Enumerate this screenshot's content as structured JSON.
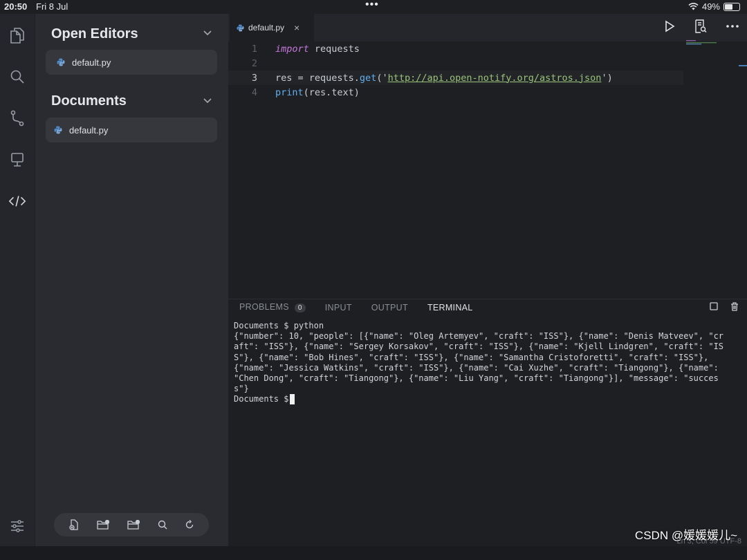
{
  "status_bar": {
    "time": "20:50",
    "date": "Fri 8 Jul",
    "battery": "49%",
    "battery_level": 0.49
  },
  "activity_bar": [
    "files-icon",
    "search-icon",
    "source-control-icon",
    "remote-icon",
    "code-icon",
    "settings-sliders-icon"
  ],
  "sidebar": {
    "open_editors": {
      "title": "Open Editors",
      "files": [
        "default.py"
      ]
    },
    "documents": {
      "title": "Documents",
      "files": [
        "default.py"
      ]
    },
    "toolbar": [
      "new-file-icon",
      "new-folder-icon",
      "open-folder-icon",
      "search-icon",
      "refresh-icon"
    ]
  },
  "editor": {
    "tab": {
      "label": "default.py",
      "close": "×"
    },
    "lines": [
      {
        "num": "1",
        "tokens": [
          [
            "kw",
            "import"
          ],
          [
            "id",
            " requests"
          ]
        ]
      },
      {
        "num": "2",
        "tokens": []
      },
      {
        "num": "3",
        "tokens": [
          [
            "id",
            "res = requests."
          ],
          [
            "fn",
            "get"
          ],
          [
            "id",
            "('"
          ],
          [
            "str",
            "http://api.open-notify.org/astros.json"
          ],
          [
            "id",
            "')"
          ]
        ]
      },
      {
        "num": "4",
        "tokens": [
          [
            "fn",
            "print"
          ],
          [
            "id",
            "(res.text)"
          ]
        ]
      }
    ],
    "current_line": 3
  },
  "panel": {
    "tabs": [
      "PROBLEMS",
      "INPUT",
      "OUTPUT",
      "TERMINAL"
    ],
    "active_tab": "TERMINAL",
    "problems_count": "0",
    "terminal": {
      "command_line": "Documents $ python",
      "output": "{\"number\": 10, \"people\": [{\"name\": \"Oleg Artemyev\", \"craft\": \"ISS\"}, {\"name\": \"Denis Matveev\", \"craft\": \"ISS\"}, {\"name\": \"Sergey Korsakov\", \"craft\": \"ISS\"}, {\"name\": \"Kjell Lindgren\", \"craft\": \"ISS\"}, {\"name\": \"Bob Hines\", \"craft\": \"ISS\"}, {\"name\": \"Samantha Cristoforetti\", \"craft\": \"ISS\"}, {\"name\": \"Jessica Watkins\", \"craft\": \"ISS\"}, {\"name\": \"Cai Xuzhe\", \"craft\": \"Tiangong\"}, {\"name\": \"Chen Dong\", \"craft\": \"Tiangong\"}, {\"name\": \"Liu Yang\", \"craft\": \"Tiangong\"}], \"message\": \"success\"}",
      "prompt": "Documents $"
    }
  },
  "footer": {
    "watermark": "CSDN @媛媛媛儿~",
    "cursor_info": "Ln 3, Col 59   UTF-8"
  }
}
